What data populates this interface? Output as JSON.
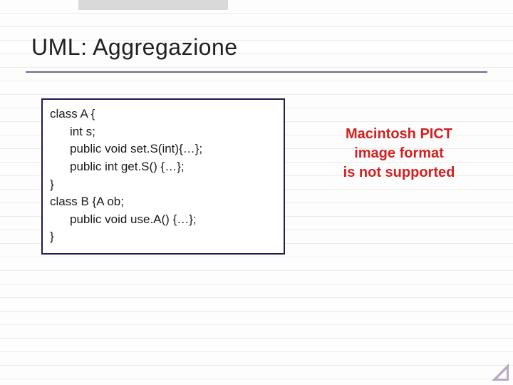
{
  "title": "UML: Aggregazione",
  "code": {
    "l1": "class A {",
    "l2": "int s;",
    "l3": "public void set.S(int){…};",
    "l4": "public int get.S() {…};",
    "l5": "}",
    "l6": "class B {A ob;",
    "l7": "public void use.A() {…};",
    "l8": "}"
  },
  "pict": {
    "line1": "Macintosh PICT",
    "line2": "image format",
    "line3": "is not supported"
  }
}
